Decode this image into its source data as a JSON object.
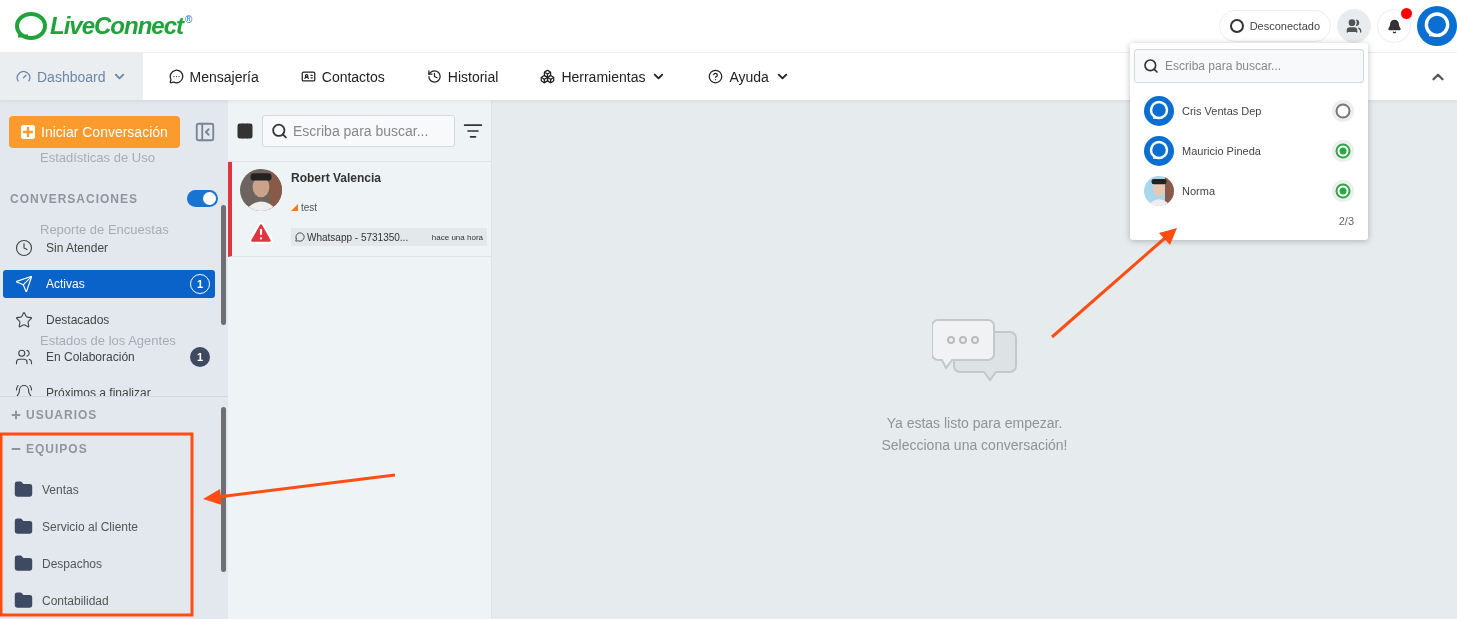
{
  "header": {
    "logo": "LiveConnect",
    "logo_mark": "®",
    "status": {
      "label": "Desconectado",
      "online": false
    },
    "notifications": {
      "unread": true
    }
  },
  "nav": {
    "items": [
      {
        "label": "Dashboard",
        "selected": true,
        "dropdown": true
      },
      {
        "label": "Mensajería",
        "selected": false,
        "dropdown": false
      },
      {
        "label": "Contactos",
        "selected": false,
        "dropdown": false
      },
      {
        "label": "Historial",
        "selected": false,
        "dropdown": false
      },
      {
        "label": "Herramientas",
        "selected": false,
        "dropdown": true
      },
      {
        "label": "Ayuda",
        "selected": false,
        "dropdown": true
      }
    ]
  },
  "sidebar": {
    "start_button": "Iniciar Conversación",
    "conversations": {
      "title": "CONVERSACIONES",
      "on": true
    },
    "items": [
      {
        "label": "Sin Atender",
        "selected": false
      },
      {
        "label": "Activas",
        "selected": true,
        "badge": "1"
      },
      {
        "label": "Destacados",
        "selected": false
      },
      {
        "label": "En Colaboración",
        "selected": false,
        "badge": "1"
      },
      {
        "label": "Próximos a finalizar",
        "selected": false
      }
    ],
    "ghost_items": [
      "Estadísticas de Uso",
      "Reporte de Encuestas",
      "Estados de los Agentes"
    ],
    "sections": [
      {
        "title": "USUARIOS",
        "expanded": false
      },
      {
        "title": "EQUIPOS",
        "expanded": true,
        "teams": [
          "Ventas",
          "Servicio al Cliente",
          "Despachos",
          "Contabilidad"
        ]
      }
    ]
  },
  "conversation_list": {
    "search": {
      "placeholder": "Escriba para buscar..."
    },
    "conversations": [
      {
        "name": "Robert Valencia",
        "preview": "test",
        "alert": true,
        "channel": "Whatsapp - 5731350...",
        "time": "hace una hora"
      }
    ]
  },
  "main": {
    "lines": [
      "Ya estas listo para empezar.",
      "Selecciona una conversación!"
    ]
  },
  "agents_dropdown": {
    "search": {
      "placeholder": "Escriba para buscar..."
    },
    "agents": [
      {
        "name": "Cris Ventas Dep",
        "online": false
      },
      {
        "name": "Mauricio Pineda",
        "online": true
      },
      {
        "name": "Norma",
        "online": true
      }
    ],
    "count": "2/3"
  }
}
